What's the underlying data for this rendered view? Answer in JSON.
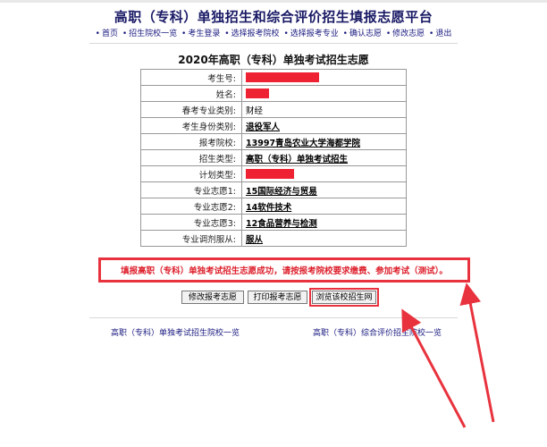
{
  "header": {
    "title": "高职（专科）单独招生和综合评价招生填报志愿平台"
  },
  "nav": {
    "items": [
      "首页",
      "招生院校一览",
      "考生登录",
      "选择报考院校",
      "选择报考专业",
      "确认志愿",
      "修改志愿",
      "退出"
    ]
  },
  "form": {
    "title": "2020年高职（专科）单独考试招生志愿",
    "rows": [
      {
        "label": "考生号:",
        "value": "",
        "redacted": true
      },
      {
        "label": "姓名:",
        "value": "",
        "redacted": true
      },
      {
        "label": "春考专业类别:",
        "value": "财经"
      },
      {
        "label": "考生身份类别:",
        "value": "退役军人"
      },
      {
        "label": "报考院校:",
        "value": "13997青岛农业大学海都学院"
      },
      {
        "label": "招生类型:",
        "value": "高职（专科）单独考试招生"
      },
      {
        "label": "计划类型:",
        "value": "",
        "redacted": true
      },
      {
        "label": "专业志愿1:",
        "value": "15国际经济与贸易"
      },
      {
        "label": "专业志愿2:",
        "value": "14软件技术"
      },
      {
        "label": "专业志愿3:",
        "value": "12食品营养与检测"
      },
      {
        "label": "专业调剂服从:",
        "value": "服从"
      }
    ]
  },
  "message": "填报高职（专科）单独考试招生志愿成功，请按报考院校要求缴费、参加考试（测试）。",
  "buttons": {
    "modify": "修改报考志愿",
    "print": "打印报考志愿",
    "browse": "浏览该校招生网"
  },
  "footer": {
    "left_link": "高职（专科）单独考试招生院校一览",
    "right_link": "高职（专科）综合评价招生院校一览"
  },
  "colors": {
    "highlight_red": "#e8333e",
    "nav_blue": "#1a1a80"
  }
}
